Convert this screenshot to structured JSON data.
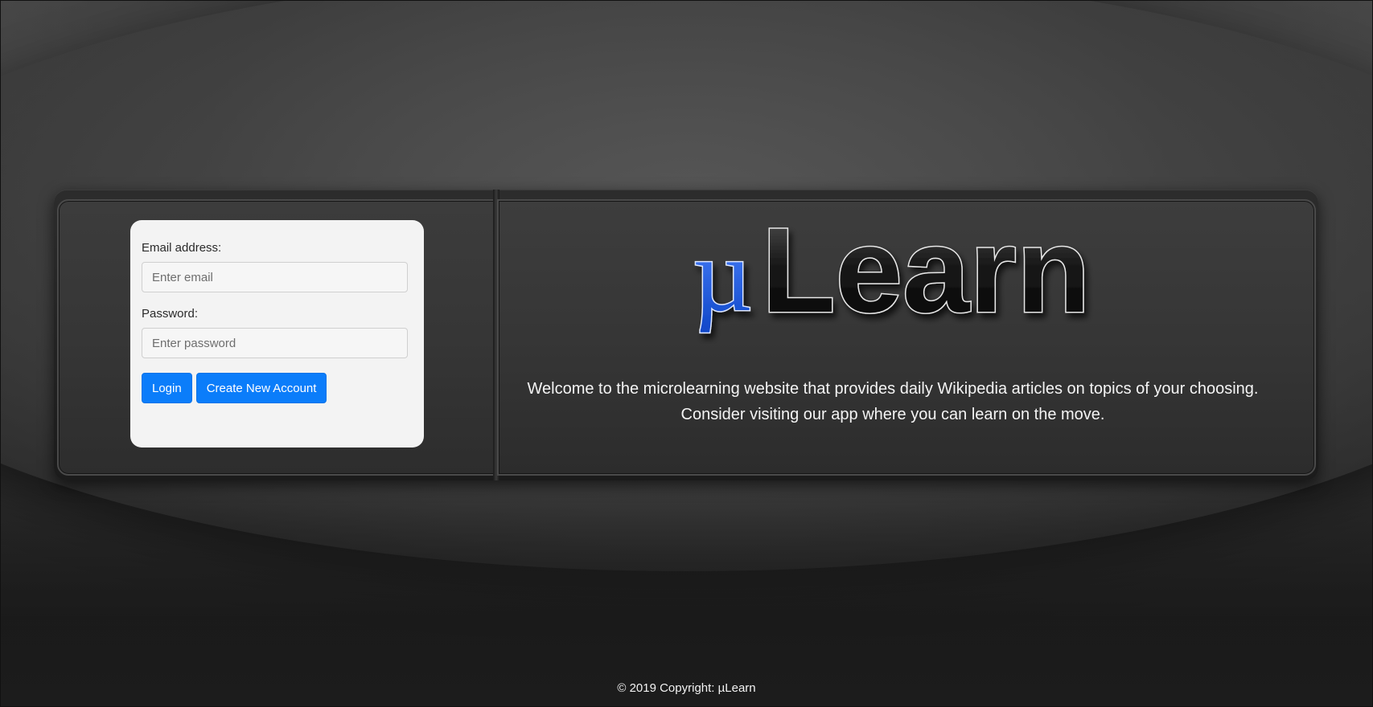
{
  "brand": {
    "name": "µLearn",
    "mu": "µ",
    "word": "Learn",
    "accent_color": "#2f6ff0"
  },
  "login": {
    "email_label": "Email address:",
    "email_placeholder": "Enter email",
    "email_value": "",
    "password_label": "Password:",
    "password_placeholder": "Enter password",
    "password_value": "",
    "login_button": "Login",
    "create_button": "Create New Account",
    "button_color": "#0b7dfa"
  },
  "welcome": {
    "line1": "Welcome to the microlearning website that provides daily Wikipedia articles on topics of your choosing.",
    "line2": "Consider visiting our app where you can learn on the move."
  },
  "footer": {
    "copyright": "© 2019 Copyright: µLearn"
  }
}
